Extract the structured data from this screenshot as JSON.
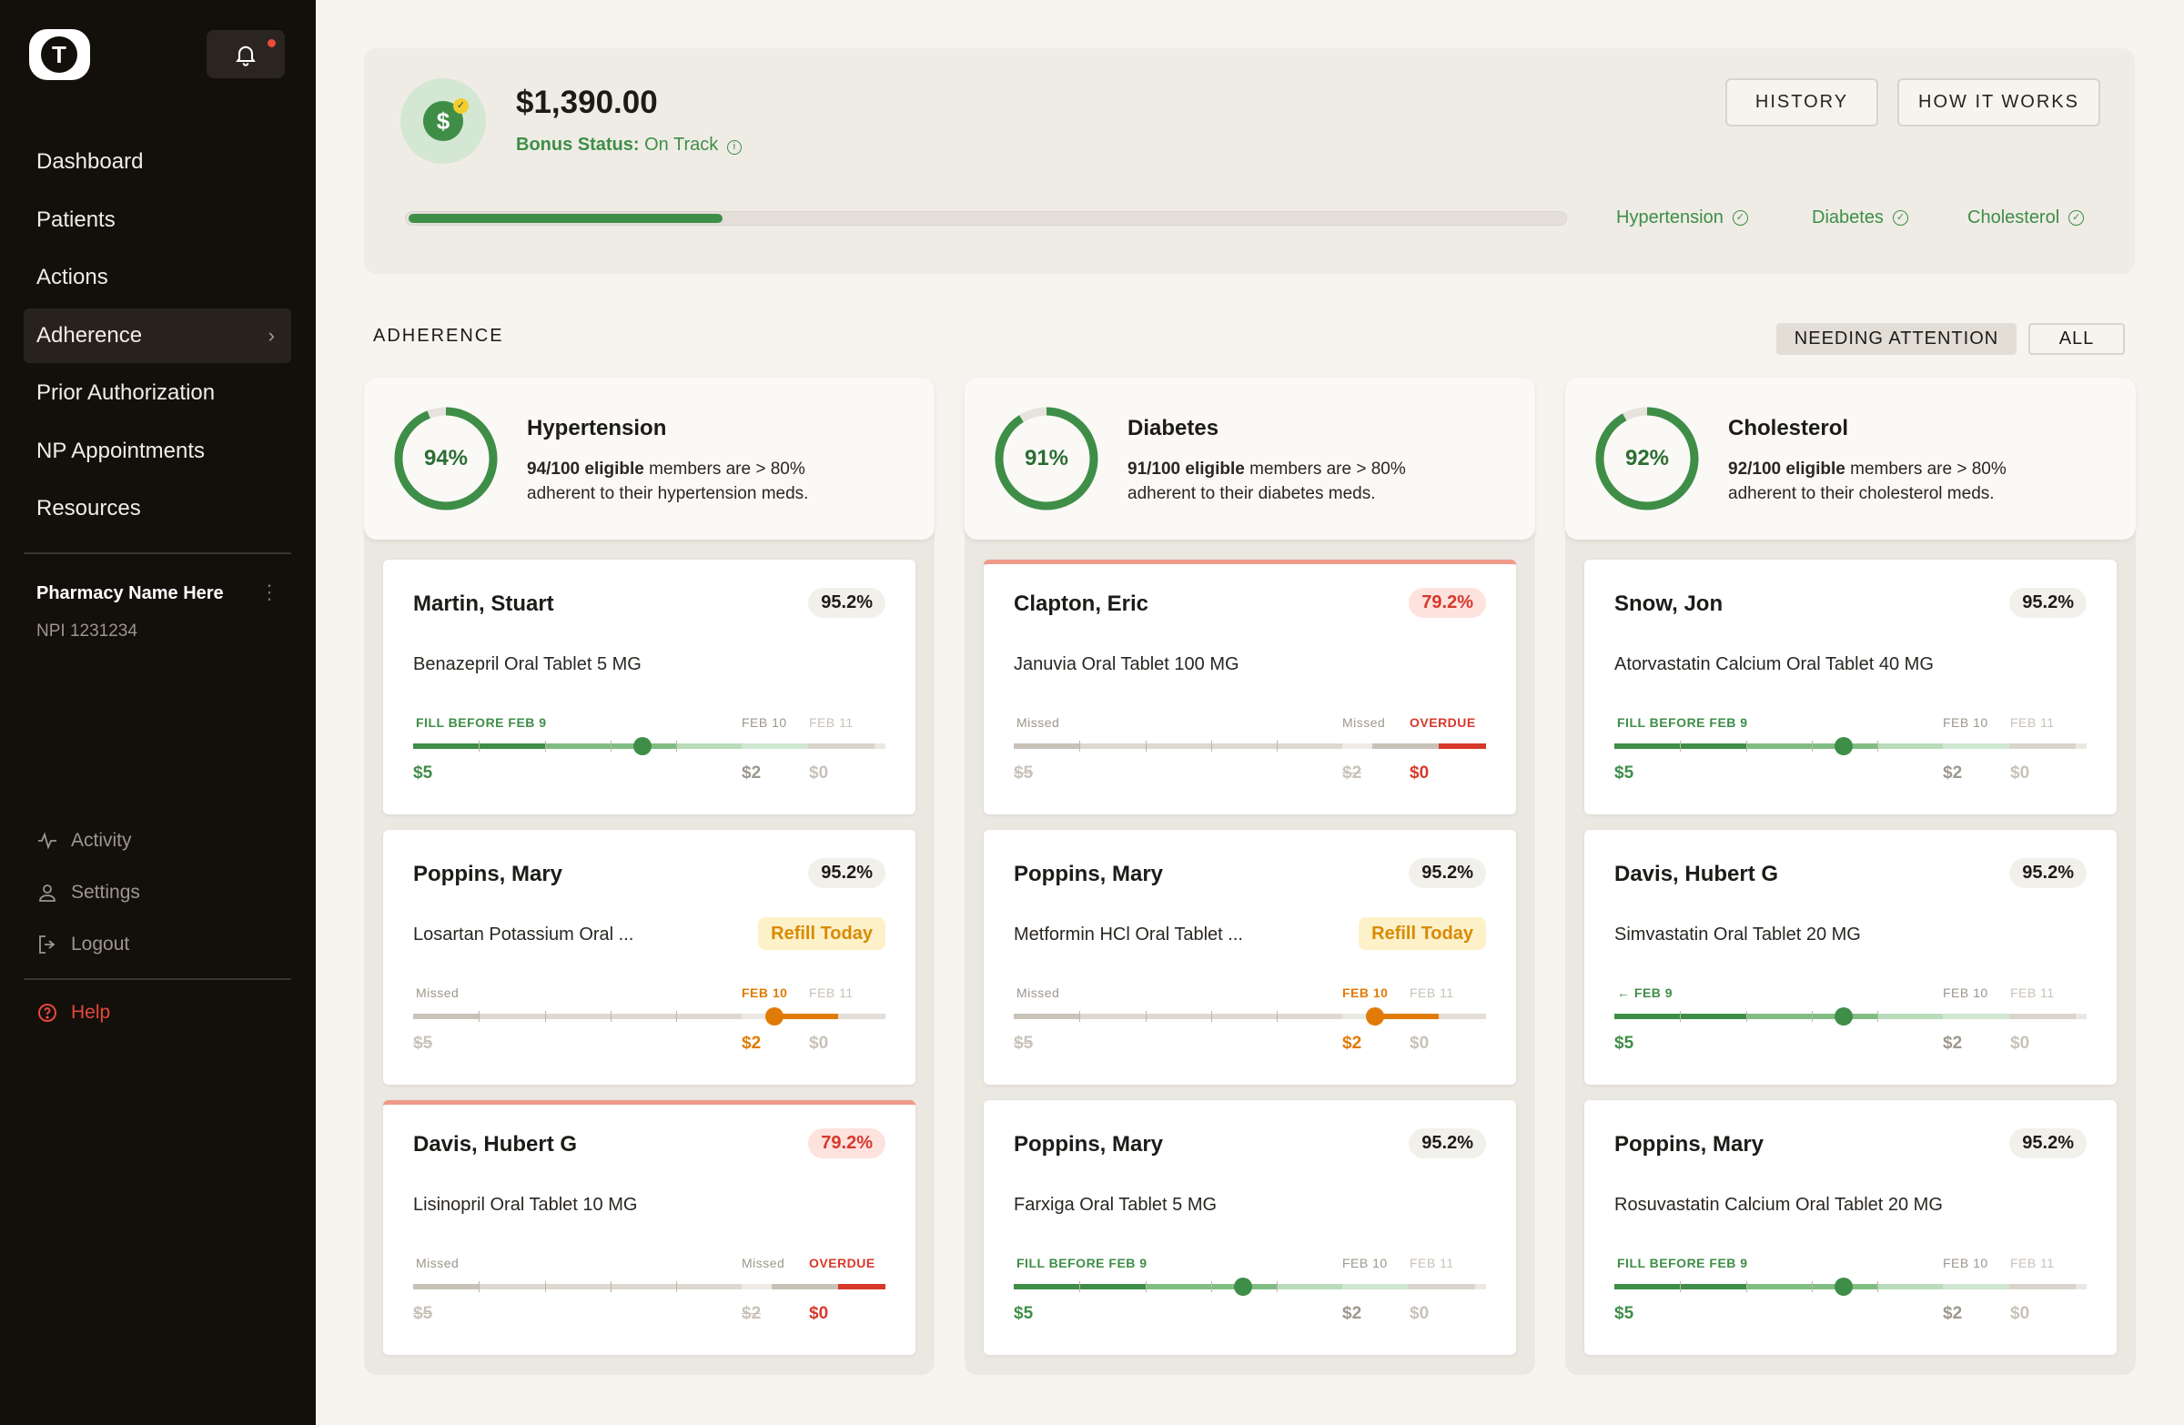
{
  "sidebar": {
    "logo_letter": "T",
    "nav": [
      {
        "label": "Dashboard"
      },
      {
        "label": "Patients"
      },
      {
        "label": "Actions"
      },
      {
        "label": "Adherence",
        "active": true
      },
      {
        "label": "Prior Authorization"
      },
      {
        "label": "NP Appointments"
      },
      {
        "label": "Resources"
      }
    ],
    "pharmacy_name": "Pharmacy Name Here",
    "npi": "NPI 1231234",
    "sub": [
      {
        "label": "Activity",
        "icon": "activity-icon"
      },
      {
        "label": "Settings",
        "icon": "user-icon"
      },
      {
        "label": "Logout",
        "icon": "logout-icon"
      }
    ],
    "help": "Help"
  },
  "bonus": {
    "amount": "$1,390.00",
    "status_label": "Bonus Status:",
    "status_value": "On Track",
    "progress": 0.27,
    "history": "HISTORY",
    "how": "HOW IT WORKS",
    "conditions": [
      "Hypertension",
      "Diabetes",
      "Cholesterol"
    ]
  },
  "adherence": {
    "title": "ADHERENCE",
    "filter_attention": "NEEDING ATTENTION",
    "filter_all": "ALL",
    "columns": [
      {
        "title": "Hypertension",
        "pct_label": "94%",
        "pct": 0.94,
        "bold": "94/100 eligible",
        "text1": " members are > 80%",
        "text2": "adherent to their hypertension meds.",
        "cards": [
          {
            "name": "Martin, Stuart",
            "pct": "95.2%",
            "alert": false,
            "med": "Benazepril Oral Tablet 5 MG",
            "refill": "",
            "state": "fill",
            "fill_label": "FILL BEFORE  FEB 9",
            "d1": "FEB 10",
            "d2": "FEB 11",
            "p0": "$5",
            "p1": "$2",
            "p2": "$0",
            "pos": 0.485
          },
          {
            "name": "Poppins, Mary",
            "pct": "95.2%",
            "alert": false,
            "med": "Losartan Potassium Oral ...",
            "refill": "Refill Today",
            "state": "refill",
            "fill_label": "Missed",
            "d1": "FEB 10",
            "d2": "FEB 11",
            "p0": "$5",
            "p1": "$2",
            "p2": "$0",
            "pos": 0.765
          },
          {
            "name": "Davis, Hubert G",
            "pct": "79.2%",
            "alert": true,
            "med": "Lisinopril Oral Tablet 10 MG",
            "refill": "",
            "state": "overdue",
            "fill_label": "Missed",
            "d1": "Missed",
            "d2": "OVERDUE",
            "p0": "$5",
            "p1": "$2",
            "p2": "$0",
            "pos": 0
          }
        ]
      },
      {
        "title": "Diabetes",
        "pct_label": "91%",
        "pct": 0.91,
        "bold": "91/100 eligible",
        "text1": " members are > 80%",
        "text2": "adherent to their diabetes meds.",
        "cards": [
          {
            "name": "Clapton, Eric",
            "pct": "79.2%",
            "alert": true,
            "med": "Januvia Oral Tablet 100 MG",
            "refill": "",
            "state": "overdue",
            "fill_label": "Missed",
            "d1": "Missed",
            "d2": "OVERDUE",
            "p0": "$5",
            "p1": "$2",
            "p2": "$0",
            "pos": 0
          },
          {
            "name": "Poppins, Mary",
            "pct": "95.2%",
            "alert": false,
            "med": "Metformin HCl Oral Tablet ...",
            "refill": "Refill Today",
            "state": "refill",
            "fill_label": "Missed",
            "d1": "FEB 10",
            "d2": "FEB 11",
            "p0": "$5",
            "p1": "$2",
            "p2": "$0",
            "pos": 0.765
          },
          {
            "name": "Poppins, Mary",
            "pct": "95.2%",
            "alert": false,
            "med": "Farxiga Oral Tablet 5 MG",
            "refill": "",
            "state": "fill",
            "fill_label": "FILL BEFORE  FEB 9",
            "d1": "FEB 10",
            "d2": "FEB 11",
            "p0": "$5",
            "p1": "$2",
            "p2": "$0",
            "pos": 0.485
          }
        ]
      },
      {
        "title": "Cholesterol",
        "pct_label": "92%",
        "pct": 0.92,
        "bold": "92/100 eligible",
        "text1": " members are > 80%",
        "text2": "adherent to their cholesterol meds.",
        "cards": [
          {
            "name": "Snow, Jon",
            "pct": "95.2%",
            "alert": false,
            "med": "Atorvastatin Calcium Oral Tablet 40 MG",
            "refill": "",
            "state": "fill",
            "fill_label": "FILL BEFORE  FEB 9",
            "d1": "FEB 10",
            "d2": "FEB 11",
            "p0": "$5",
            "p1": "$2",
            "p2": "$0",
            "pos": 0.485
          },
          {
            "name": "Davis, Hubert G",
            "pct": "95.2%",
            "alert": false,
            "med": "Simvastatin Oral Tablet 20 MG",
            "refill": "",
            "state": "fill",
            "fill_label": "← FEB 9",
            "d1": "FEB 10",
            "d2": "FEB 11",
            "p0": "$5",
            "p1": "$2",
            "p2": "$0",
            "pos": 0.485
          },
          {
            "name": "Poppins, Mary",
            "pct": "95.2%",
            "alert": false,
            "med": "Rosuvastatin Calcium Oral Tablet 20 MG",
            "refill": "",
            "state": "fill",
            "fill_label": "FILL BEFORE  FEB 9",
            "d1": "FEB 10",
            "d2": "FEB 11",
            "p0": "$5",
            "p1": "$2",
            "p2": "$0",
            "pos": 0.485
          }
        ]
      }
    ]
  },
  "colors": {
    "green": "#3e8e47",
    "orange": "#e17b07",
    "red": "#d7392b",
    "sidebar": "#130f0b"
  }
}
